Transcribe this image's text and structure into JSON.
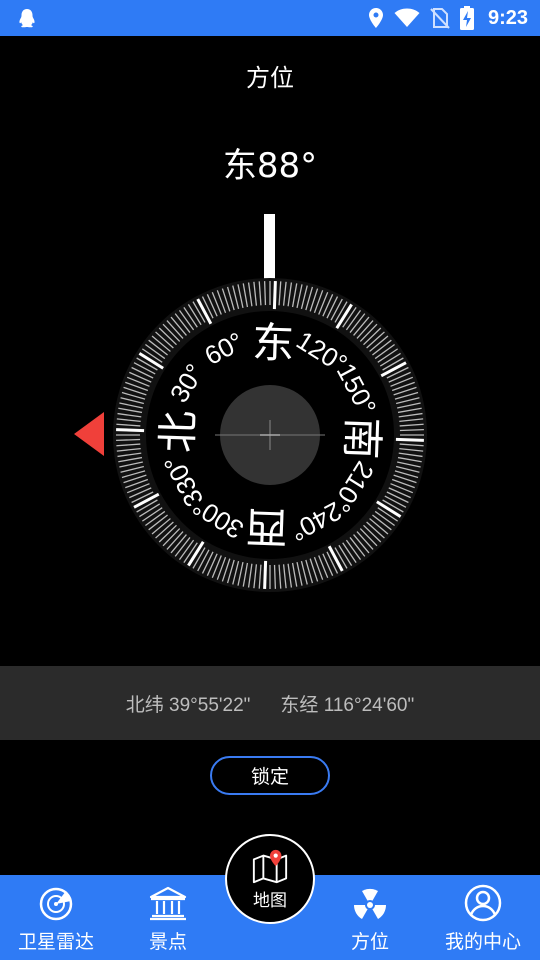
{
  "status_bar": {
    "time": "9:23"
  },
  "page_title": "方位",
  "heading": {
    "direction": "东",
    "degrees": "88°",
    "text": "东88°"
  },
  "compass": {
    "cardinals": {
      "north": "北",
      "east": "东",
      "south": "南",
      "west": "西"
    },
    "ring_labels": [
      "30°",
      "60°",
      "120°",
      "150°",
      "210°",
      "240°",
      "300°",
      "330°"
    ]
  },
  "location": {
    "latitude": "北纬 39°55'22\"",
    "longitude": "东经 116°24'60\""
  },
  "lock_button": "锁定",
  "bottom_nav": {
    "items": [
      {
        "label": "卫星雷达",
        "icon": "radar-icon"
      },
      {
        "label": "景点",
        "icon": "landmark-icon"
      },
      {
        "label": "地图",
        "icon": "map-pin-icon"
      },
      {
        "label": "方位",
        "icon": "radiation-icon"
      },
      {
        "label": "我的中心",
        "icon": "user-icon"
      }
    ]
  },
  "colors": {
    "accent": "#2f7bf5",
    "pointer": "#f0403a",
    "band": "#2b2b2b"
  }
}
